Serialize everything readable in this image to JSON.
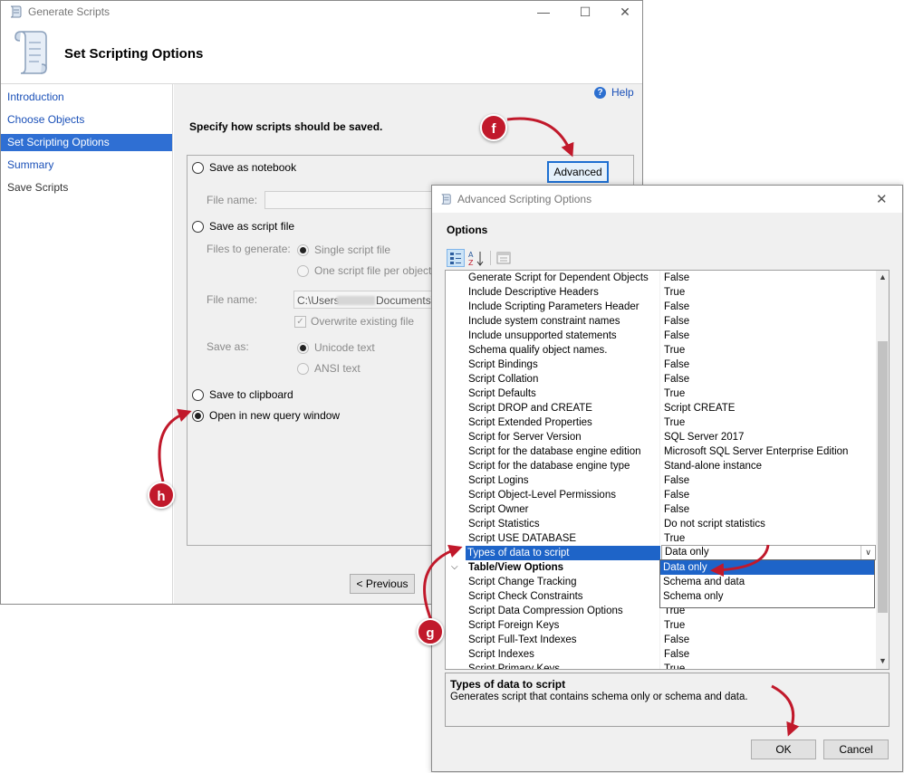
{
  "main_window": {
    "title": "Generate Scripts",
    "header_title": "Set Scripting Options",
    "help_label": "Help",
    "nav": [
      {
        "label": "Introduction"
      },
      {
        "label": "Choose Objects"
      },
      {
        "label": "Set Scripting Options"
      },
      {
        "label": "Summary"
      },
      {
        "label": "Save Scripts"
      }
    ],
    "active_nav": "Set Scripting Options",
    "specify_label": "Specify how scripts should be saved.",
    "save_as_notebook": "Save as notebook",
    "advanced_button": "Advanced",
    "file_name_label": "File name:",
    "save_as_script_file": "Save as script file",
    "files_to_generate_label": "Files to generate:",
    "single_script_file": "Single script file",
    "one_script_per_object": "One script file per object",
    "file_name_label_2": "File name:",
    "file_path_start": "C:\\Users",
    "file_path_end": "Documents\\s",
    "overwrite_existing": "Overwrite existing file",
    "save_as_label": "Save as:",
    "unicode_text": "Unicode text",
    "ansi_text": "ANSI text",
    "save_to_clipboard": "Save to clipboard",
    "open_new_query": "Open in new query window",
    "previous_button": "< Previous"
  },
  "dialog": {
    "title": "Advanced Scripting Options",
    "options_label": "Options",
    "toolbar": {
      "categorized_icon": "categorized-icon",
      "alphabetical_icon": "sort-az-icon",
      "pages_icon": "property-pages-icon"
    },
    "properties": [
      {
        "name": "Generate Script for Dependent Objects",
        "value": "False"
      },
      {
        "name": "Include Descriptive Headers",
        "value": "True"
      },
      {
        "name": "Include Scripting Parameters Header",
        "value": "False"
      },
      {
        "name": "Include system constraint names",
        "value": "False"
      },
      {
        "name": "Include unsupported statements",
        "value": "False"
      },
      {
        "name": "Schema qualify object names.",
        "value": "True"
      },
      {
        "name": "Script Bindings",
        "value": "False"
      },
      {
        "name": "Script Collation",
        "value": "False"
      },
      {
        "name": "Script Defaults",
        "value": "True"
      },
      {
        "name": "Script DROP and CREATE",
        "value": "Script CREATE"
      },
      {
        "name": "Script Extended Properties",
        "value": "True"
      },
      {
        "name": "Script for Server Version",
        "value": "SQL Server 2017"
      },
      {
        "name": "Script for the database engine edition",
        "value": "Microsoft SQL Server Enterprise Edition"
      },
      {
        "name": "Script for the database engine type",
        "value": "Stand-alone instance"
      },
      {
        "name": "Script Logins",
        "value": "False"
      },
      {
        "name": "Script Object-Level Permissions",
        "value": "False"
      },
      {
        "name": "Script Owner",
        "value": "False"
      },
      {
        "name": "Script Statistics",
        "value": "Do not script statistics"
      },
      {
        "name": "Script USE DATABASE",
        "value": "True"
      },
      {
        "name": "Types of data to script",
        "value": "Data only",
        "selected": true
      }
    ],
    "category": "Table/View Options",
    "table_view_properties": [
      {
        "name": "Script Change Tracking",
        "value": ""
      },
      {
        "name": "Script Check Constraints",
        "value": ""
      },
      {
        "name": "Script Data Compression Options",
        "value": "True"
      },
      {
        "name": "Script Foreign Keys",
        "value": "True"
      },
      {
        "name": "Script Full-Text Indexes",
        "value": "False"
      },
      {
        "name": "Script Indexes",
        "value": "False"
      },
      {
        "name": "Script Primary Keys",
        "value": "True"
      }
    ],
    "dropdown_value": "Data only",
    "dropdown_options": [
      "Data only",
      "Schema and data",
      "Schema only"
    ],
    "description_title": "Types of data to script",
    "description_text": "Generates script that contains schema only or schema and data.",
    "ok_button": "OK",
    "cancel_button": "Cancel"
  },
  "callouts": {
    "f": "f",
    "g": "g",
    "h": "h",
    "color": "#c1192b"
  }
}
